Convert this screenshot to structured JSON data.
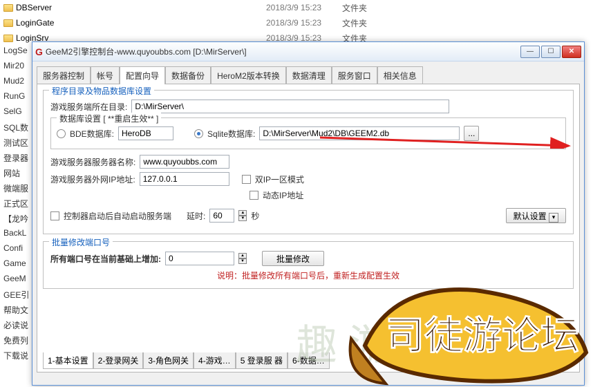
{
  "bg": {
    "rows": [
      {
        "name": "DBServer",
        "date": "2018/3/9 15:23",
        "type": "文件夹"
      },
      {
        "name": "LoginGate",
        "date": "2018/3/9 15:23",
        "type": "文件夹"
      },
      {
        "name": "LoginSrv",
        "date": "2018/3/9 15:23",
        "type": "文件夹"
      }
    ]
  },
  "sidebar": [
    "LogSe",
    "Mir20",
    "Mud2",
    "RunG",
    "SelG",
    "SQL数",
    "测试区",
    "登录器",
    "网站",
    "微端服",
    "正式区",
    "【龙吟",
    "BackL",
    "Confi",
    "Game",
    "GeeM",
    "GEE引",
    "帮助文",
    "必读说",
    "免费列",
    "下载说"
  ],
  "win": {
    "title": "GeeM2引擎控制台-www.quyoubbs.com [D:\\MirServer\\]"
  },
  "tabs": [
    "服务器控制",
    "帐号",
    "配置向导",
    "数据备份",
    "HeroM2版本转换",
    "数据清理",
    "服务窗口",
    "相关信息"
  ],
  "active_tab": 2,
  "group1": {
    "legend": "程序目录及物品数据库设置",
    "dir_label": "游戏服务端所在目录:",
    "dir_value": "D:\\MirServer\\",
    "db_legend": "数据库设置 [ **重启生效** ]",
    "bde_label": "BDE数据库:",
    "bde_value": "HeroDB",
    "sqlite_label": "Sqlite数据库:",
    "sqlite_value": "D:\\MirServer\\Mud2\\DB\\GEEM2.db",
    "srvname_label": "游戏服务器服务器名称:",
    "srvname_value": "www.quyoubbs.com",
    "ip_label": "游戏服务器外网IP地址:",
    "ip_value": "127.0.0.1",
    "dualip": "双IP一区模式",
    "dynip": "动态IP地址",
    "autostart": "控制器启动后自动启动服务端",
    "delay_label": "延时:",
    "delay_value": "60",
    "delay_unit": "秒",
    "default_btn": "默认设置"
  },
  "group2": {
    "legend": "批量修改端口号",
    "port_label": "所有端口号在当前基础上增加:",
    "port_value": "0",
    "batch_btn": "批量修改",
    "note": "说明：批量修改所有端口号后，重新生成配置生效"
  },
  "subtabs": [
    "1-基本设置",
    "2-登录网关",
    "3-角色网关",
    "4-游戏…",
    "5 登录服 器",
    "6-数据…"
  ],
  "browse_btn": "..."
}
